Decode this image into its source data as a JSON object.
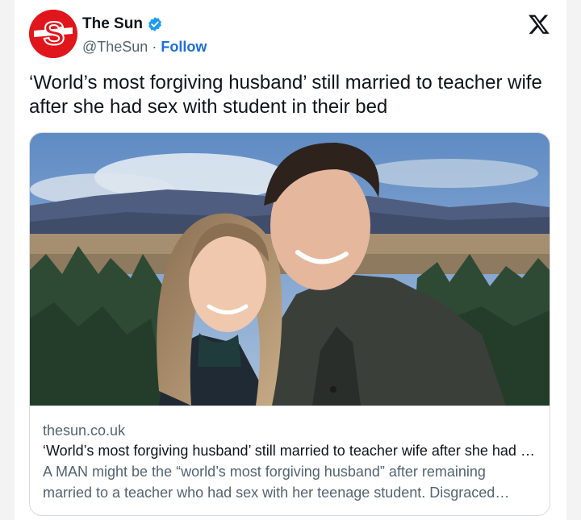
{
  "account": {
    "name": "The Sun",
    "handle": "@TheSun",
    "separator": " · ",
    "follow_label": "Follow",
    "avatar_letter": "S",
    "brand_color": "#e1161c",
    "verified_color": "#1d9bf0"
  },
  "tweet": {
    "text": "‘World’s most forgiving husband’ still married to teacher wife after she had sex with student in their bed"
  },
  "card": {
    "domain": "thesun.co.uk",
    "title": "‘World’s most forgiving husband’ still married to teacher wife after she had sex with student in their bed",
    "description": "A MAN might be the “world’s most forgiving husband” after remaining married to a teacher who had sex with her teenage student. Disgraced teacher"
  },
  "icons": {
    "brand": "x-logo-icon",
    "verified": "verified-badge-icon"
  }
}
